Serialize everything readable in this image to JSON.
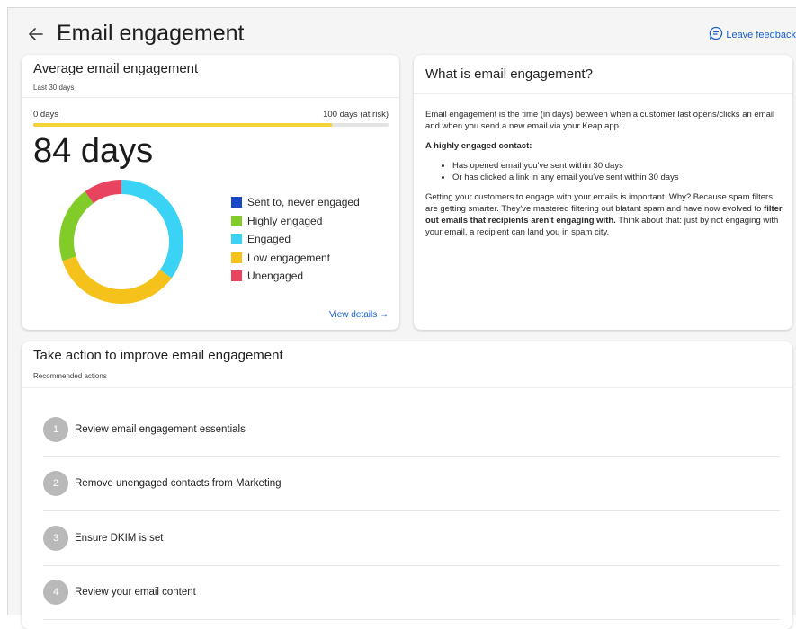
{
  "header": {
    "title": "Email engagement",
    "feedback_label": "Leave feedback"
  },
  "engagement_card": {
    "title": "Average email engagement",
    "subtitle": "Last 30 days",
    "range_min_label": "0 days",
    "range_max_label": "100 days (at risk)",
    "progress_fraction": 0.84,
    "value": "84 days",
    "view_details_label": "View details →",
    "legend": [
      {
        "label": "Sent to, never engaged",
        "color": "#1947c8",
        "share": 0.0
      },
      {
        "label": "Highly engaged",
        "color": "#82cc2a",
        "share": 0.2
      },
      {
        "label": "Engaged",
        "color": "#3ad3f5",
        "share": 0.35
      },
      {
        "label": "Low engagement",
        "color": "#f5c21b",
        "share": 0.35
      },
      {
        "label": "Unengaged",
        "color": "#e8435f",
        "share": 0.1
      }
    ]
  },
  "what_card": {
    "title": "What is email engagement?",
    "para1": "Email engagement is the time (in days) between when a customer last opens/clicks an email and when you send a new email via your Keap app.",
    "highlight_heading": "A highly engaged contact:",
    "bullets": [
      "Has opened email you've sent within 30 days",
      "Or has clicked a link in any email you've sent within 30 days"
    ],
    "para2_a": "Getting your customers to engage with your emails is important. Why? Because spam filters are getting smarter. They've mastered filtering out blatant spam and have now evolved to ",
    "para2_bold": "filter out emails that recipients aren't engaging with.",
    "para2_b": " Think about that: just by not engaging with your email, a recipient can land you in spam city."
  },
  "action_card": {
    "title": "Take action to improve email engagement",
    "subtitle": "Recommended actions",
    "actions": [
      {
        "number": "1",
        "label": "Review email engagement essentials"
      },
      {
        "number": "2",
        "label": "Remove unengaged contacts from Marketing"
      },
      {
        "number": "3",
        "label": "Ensure DKIM is set"
      },
      {
        "number": "4",
        "label": "Review your email content"
      }
    ]
  }
}
